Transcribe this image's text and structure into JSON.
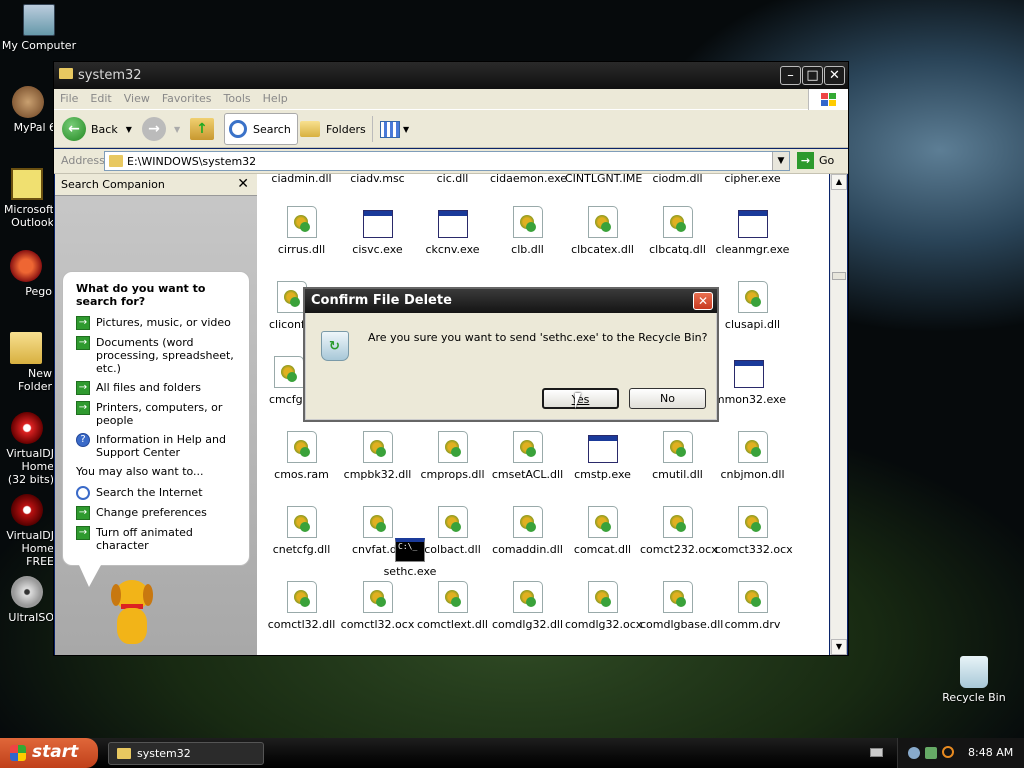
{
  "desktop": {
    "icons": [
      {
        "label": "My Computer",
        "icon": "my-computer-icon"
      },
      {
        "label": "MyPal 6",
        "icon": "mypal-icon"
      },
      {
        "label": "Microsoft Outlook",
        "icon": "outlook-icon"
      },
      {
        "label": "Pego",
        "icon": "pego-icon"
      },
      {
        "label": "New Folder",
        "icon": "folder-icon"
      },
      {
        "label": "VirtualDJ Home (32 bits)",
        "icon": "virtualdj-icon"
      },
      {
        "label": "VirtualDJ Home FREE",
        "icon": "virtualdj-free-icon"
      },
      {
        "label": "UltraISO",
        "icon": "ultraiso-icon"
      },
      {
        "label": "Recycle Bin",
        "icon": "recycle-bin-icon"
      }
    ]
  },
  "window": {
    "title": "system32",
    "menu": [
      "File",
      "Edit",
      "View",
      "Favorites",
      "Tools",
      "Help"
    ],
    "toolbar": {
      "back": "Back",
      "search": "Search",
      "folders": "Folders"
    },
    "address_label": "Address",
    "address_value": "E:\\WINDOWS\\system32",
    "go": "Go"
  },
  "sidebar": {
    "title": "Search Companion",
    "question": "What do you want to search for?",
    "options": [
      "Pictures, music, or video",
      "Documents (word processing, spreadsheet, etc.)",
      "All files and folders",
      "Printers, computers, or people",
      "Information in Help and Support Center"
    ],
    "also_label": "You may also want to...",
    "also": [
      "Search the Internet",
      "Change preferences",
      "Turn off animated character"
    ]
  },
  "files": {
    "top_row": [
      "ciadmin.dll",
      "ciadv.msc",
      "cic.dll",
      "cidaemon.exe",
      "CINTLGNT.IME",
      "ciodm.dll",
      "cipher.exe"
    ],
    "row1": [
      "cirrus.dll",
      "cisvc.exe",
      "ckcnv.exe",
      "clb.dll",
      "clbcatex.dll",
      "clbcatq.dll",
      "cleanmgr.exe"
    ],
    "row2": [
      "cliconf",
      "",
      "",
      "",
      "",
      "",
      "clusapi.dll"
    ],
    "row3": [
      "cmcfg3",
      "",
      "",
      "",
      "",
      "",
      "mmon32.exe"
    ],
    "row4": [
      "cmos.ram",
      "cmpbk32.dll",
      "cmprops.dll",
      "cmsetACL.dll",
      "cmstp.exe",
      "cmutil.dll",
      "cnbjmon.dll"
    ],
    "row5": [
      "cnetcfg.dll",
      "cnvfat.dll",
      "colbact.dll",
      "comaddin.dll",
      "comcat.dll",
      "comct232.ocx",
      "comct332.ocx"
    ],
    "row6": [
      "comctl32.dll",
      "comctl32.ocx",
      "comctlext.dll",
      "comdlg32.dll",
      "comdlg32.ocx",
      "comdlgbase.dll",
      "comm.drv"
    ],
    "dragging": "sethc.exe"
  },
  "dialog": {
    "title": "Confirm File Delete",
    "message": "Are you sure you want to send 'sethc.exe' to the Recycle Bin?",
    "yes": "Yes",
    "no": "No"
  },
  "taskbar": {
    "start": "start",
    "task": "system32",
    "time": "8:48 AM"
  }
}
